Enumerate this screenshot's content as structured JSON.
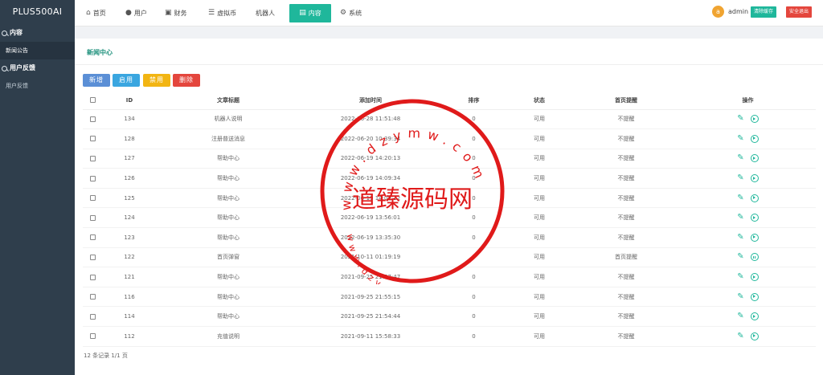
{
  "brand": "PLUS500AI",
  "sidebar": {
    "groups": [
      {
        "title": "内容",
        "items": [
          {
            "label": "新闻公告"
          }
        ]
      },
      {
        "title": "用户反馈",
        "items": [
          {
            "label": "用户反馈"
          }
        ]
      }
    ]
  },
  "topnav": {
    "items": [
      {
        "label": "首页",
        "icon": "home-icon"
      },
      {
        "label": "用户",
        "icon": "user-icon"
      },
      {
        "label": "财务",
        "icon": "finance-icon"
      },
      {
        "label": "虚拟币",
        "icon": "coin-icon"
      },
      {
        "label": "机器人",
        "icon": ""
      },
      {
        "label": "内容",
        "icon": "document-icon"
      },
      {
        "label": "系统",
        "icon": "gear-icon"
      }
    ],
    "avatar_letter": "a",
    "username": "admin",
    "clear_cache": "清除缓存",
    "logout": "安全退出"
  },
  "page": {
    "title": "新闻中心",
    "buttons": {
      "add": "新增",
      "enable": "启用",
      "disable": "禁用",
      "delete": "删除"
    },
    "footer": "12 条记录 1/1 页"
  },
  "colors": {
    "accent": "#1fb79b",
    "sidebar": "#2f3e4c",
    "btn_add": "#5b8fd6",
    "btn_enable": "#3aa6e0",
    "btn_disable": "#f2b513",
    "btn_delete": "#e4463d",
    "stamp": "#e01a1a"
  },
  "table": {
    "headers": [
      "ID",
      "文章标题",
      "添加时间",
      "排序",
      "状态",
      "首页提醒",
      "操作"
    ],
    "rows": [
      {
        "id": "134",
        "title": "机器人说明",
        "time": "2022-06-28 11:51:48",
        "sort": "0",
        "status": "可用",
        "reminder": "不提醒",
        "toggle": "play"
      },
      {
        "id": "128",
        "title": "注册普送消息",
        "time": "2022-06-20 10:39:34",
        "sort": "0",
        "status": "可用",
        "reminder": "不提醒",
        "toggle": "play"
      },
      {
        "id": "127",
        "title": "帮助中心",
        "time": "2022-06-19 14:20:13",
        "sort": "0",
        "status": "可用",
        "reminder": "不提醒",
        "toggle": "play"
      },
      {
        "id": "126",
        "title": "帮助中心",
        "time": "2022-06-19 14:09:34",
        "sort": "0",
        "status": "可用",
        "reminder": "不提醒",
        "toggle": "play"
      },
      {
        "id": "125",
        "title": "帮助中心",
        "time": "2022-06-19 14:05:12",
        "sort": "0",
        "status": "可用",
        "reminder": "不提醒",
        "toggle": "play"
      },
      {
        "id": "124",
        "title": "帮助中心",
        "time": "2022-06-19 13:56:01",
        "sort": "0",
        "status": "可用",
        "reminder": "不提醒",
        "toggle": "play"
      },
      {
        "id": "123",
        "title": "帮助中心",
        "time": "2022-06-19 13:35:30",
        "sort": "0",
        "status": "可用",
        "reminder": "不提醒",
        "toggle": "play"
      },
      {
        "id": "122",
        "title": "首页弹窗",
        "time": "2021-10-11 01:19:19",
        "sort": "0",
        "status": "可用",
        "reminder": "首页提醒",
        "toggle": "pause"
      },
      {
        "id": "121",
        "title": "帮助中心",
        "time": "2021-09-25 21:57:47",
        "sort": "0",
        "status": "可用",
        "reminder": "不提醒",
        "toggle": "play"
      },
      {
        "id": "116",
        "title": "帮助中心",
        "time": "2021-09-25 21:55:15",
        "sort": "0",
        "status": "可用",
        "reminder": "不提醒",
        "toggle": "play"
      },
      {
        "id": "114",
        "title": "帮助中心",
        "time": "2021-09-25 21:54:44",
        "sort": "0",
        "status": "可用",
        "reminder": "不提醒",
        "toggle": "play"
      },
      {
        "id": "112",
        "title": "充值说明",
        "time": "2021-09-11 15:58:33",
        "sort": "0",
        "status": "可用",
        "reminder": "不提醒",
        "toggle": "play"
      }
    ]
  },
  "watermark": {
    "center_text": "道臻源码网",
    "ring_text": "www.dzymw.com"
  }
}
